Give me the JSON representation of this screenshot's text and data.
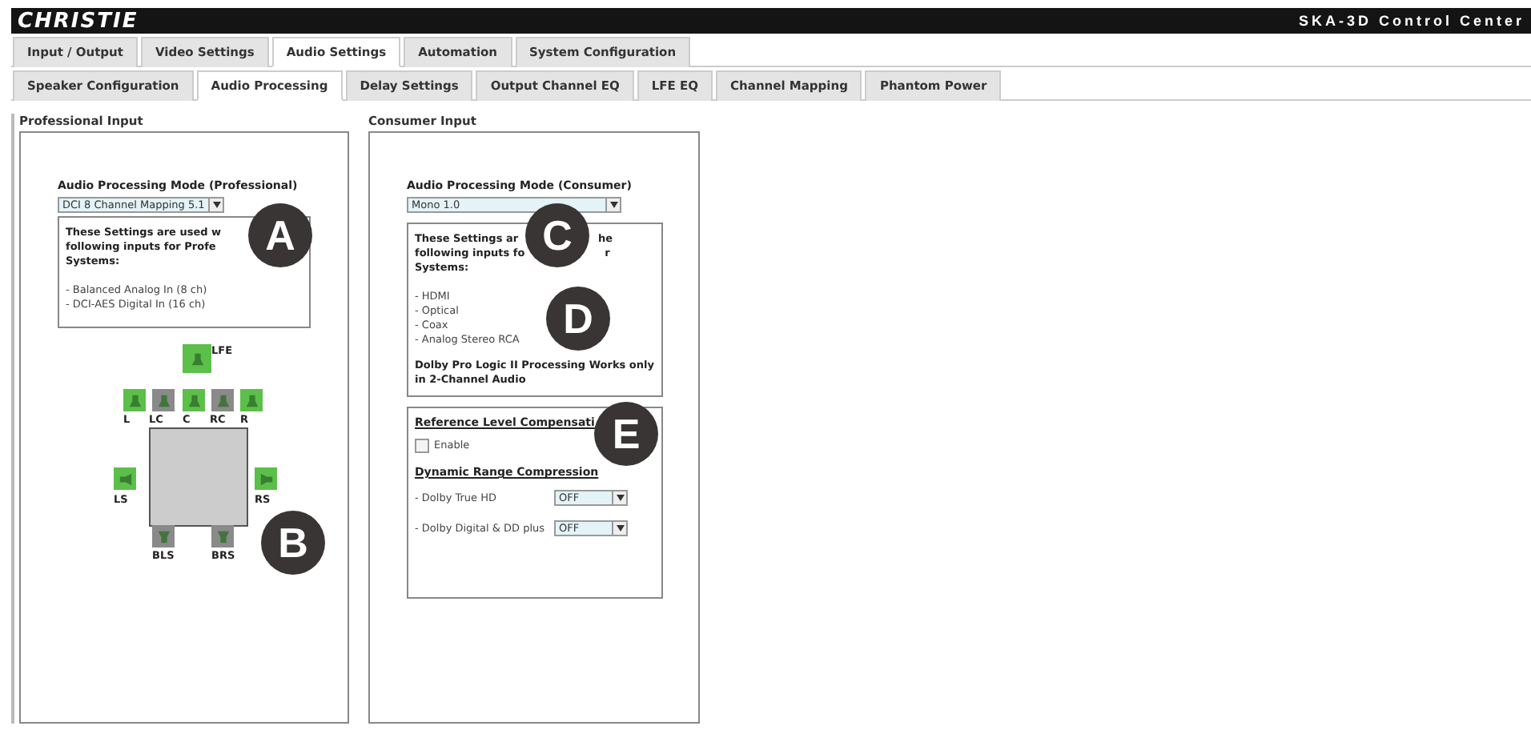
{
  "header": {
    "logo": "CHRISTIE",
    "title": "SKA-3D Control Center"
  },
  "tabs": [
    {
      "label": "Input / Output",
      "selected": false
    },
    {
      "label": "Video Settings",
      "selected": false
    },
    {
      "label": "Audio Settings",
      "selected": true
    },
    {
      "label": "Automation",
      "selected": false
    },
    {
      "label": "System Configuration",
      "selected": false
    }
  ],
  "subtabs": [
    {
      "label": "Speaker Configuration",
      "selected": false
    },
    {
      "label": "Audio Processing",
      "selected": true
    },
    {
      "label": "Delay Settings",
      "selected": false
    },
    {
      "label": "Output Channel EQ",
      "selected": false
    },
    {
      "label": "LFE EQ",
      "selected": false
    },
    {
      "label": "Channel Mapping",
      "selected": false
    },
    {
      "label": "Phantom Power",
      "selected": false
    }
  ],
  "professional": {
    "heading": "Professional Input",
    "mode_label": "Audio Processing Mode (Professional)",
    "mode_value": "DCI 8 Channel Mapping 5.1",
    "info_lines": [
      [
        "These Settings are used w"
      ],
      [
        "following inputs for Profe"
      ],
      [
        "Systems:"
      ]
    ],
    "inputs": [
      "- Balanced Analog In (8 ch)",
      "- DCI-AES Digital In (16 ch)"
    ],
    "speakers": [
      {
        "label": "LFE",
        "on": true,
        "kind": "front"
      },
      {
        "label": "L",
        "on": true,
        "kind": "front"
      },
      {
        "label": "LC",
        "on": false,
        "kind": "front"
      },
      {
        "label": "C",
        "on": true,
        "kind": "front"
      },
      {
        "label": "RC",
        "on": false,
        "kind": "front"
      },
      {
        "label": "R",
        "on": true,
        "kind": "front"
      },
      {
        "label": "LS",
        "on": true,
        "kind": "left"
      },
      {
        "label": "RS",
        "on": true,
        "kind": "right"
      },
      {
        "label": "BLS",
        "on": false,
        "kind": "back"
      },
      {
        "label": "BRS",
        "on": false,
        "kind": "back"
      }
    ]
  },
  "consumer": {
    "heading": "Consumer Input",
    "mode_label": "Audio Processing Mode (Consumer)",
    "mode_value": "Mono 1.0",
    "info_lines": [
      [
        "These Settings ar",
        "he"
      ],
      [
        "following inputs fo",
        "r"
      ],
      [
        "Systems:"
      ]
    ],
    "inputs": [
      "- HDMI",
      "- Optical",
      "- Coax",
      "- Analog Stereo RCA"
    ],
    "note": "Dolby Pro Logic II Processing Works only in 2-Channel Audio",
    "ref_heading": "Reference Level Compensati",
    "enable": {
      "label": "Enable",
      "checked": false
    },
    "drc_heading": "Dynamic Range Compression",
    "drc": [
      {
        "label": "- Dolby True HD",
        "value": "OFF"
      },
      {
        "label": "- Dolby Digital & DD plus",
        "value": "OFF"
      }
    ]
  },
  "callouts": [
    "A",
    "B",
    "C",
    "D",
    "E"
  ]
}
